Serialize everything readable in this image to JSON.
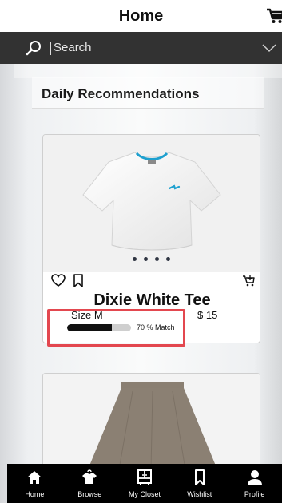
{
  "header": {
    "title": "Home",
    "cart_icon": "cart-icon"
  },
  "search": {
    "placeholder": "Search",
    "icon": "search-icon",
    "dropdown_icon": "chevron-down-icon"
  },
  "section": {
    "title": "Daily Recommendations"
  },
  "product": {
    "name": "Dixie White Tee",
    "size": "Size M",
    "price": "$ 15",
    "match_text": "70 % Match",
    "match_fraction": 0.7,
    "carousel_dots": 4,
    "icons": [
      "heart-icon",
      "bookmark-icon",
      "cart-icon"
    ]
  },
  "bottom_nav": {
    "items": [
      {
        "label": "Home",
        "icon": "home-icon"
      },
      {
        "label": "Browse",
        "icon": "hanger-shirt-icon"
      },
      {
        "label": "My Closet",
        "icon": "closet-icon"
      },
      {
        "label": "Wishlist",
        "icon": "bookmark-icon"
      },
      {
        "label": "Profile",
        "icon": "profile-icon"
      }
    ]
  },
  "colors": {
    "search_bg": "#323232",
    "nav_bg": "#000000",
    "highlight": "#e3474f",
    "logo_blue": "#29a8d8"
  }
}
